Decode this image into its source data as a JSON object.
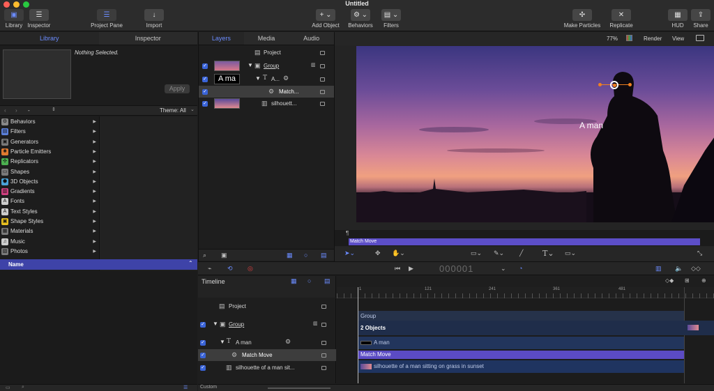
{
  "window": {
    "title": "Untitled"
  },
  "toolbar": {
    "library": "Library",
    "inspector": "Inspector",
    "project_pane": "Project Pane",
    "import": "Import",
    "add_object": "Add Object",
    "behaviors": "Behaviors",
    "filters": "Filters",
    "make_particles": "Make Particles",
    "replicate": "Replicate",
    "hud": "HUD",
    "share": "Share"
  },
  "left": {
    "tabs": [
      "Library",
      "Inspector"
    ],
    "nothing_selected": "Nothing Selected.",
    "apply": "Apply",
    "path_value": "-",
    "theme": "Theme: All",
    "categories": [
      "Behaviors",
      "Filters",
      "Generators",
      "Particle Emitters",
      "Replicators",
      "Shapes",
      "3D Objects",
      "Gradients",
      "Fonts",
      "Text Styles",
      "Shape Styles",
      "Materials",
      "Music",
      "Photos"
    ],
    "category_colors": [
      "#888888",
      "#5a7fd8",
      "#7a7a7a",
      "#e07a30",
      "#4caf50",
      "#7a7a7a",
      "#4aa3d8",
      "#d04080",
      "#cccccc",
      "#cccccc",
      "#e8c020",
      "#7a7a7a",
      "#cccccc",
      "#7a7a7a"
    ],
    "name_header": "Name"
  },
  "layers": {
    "tabs": [
      "Layers",
      "Media",
      "Audio"
    ],
    "project": "Project",
    "group": "Group",
    "text_layer": "A...",
    "text_thumb": "A ma",
    "match": "Match...",
    "silhouette": "silhouett..."
  },
  "canvas": {
    "zoom": "77%",
    "render": "Render",
    "view": "View",
    "overlay_text": "A man",
    "mini_timeline_label": "Match Move"
  },
  "transport": {
    "timecode": "000001"
  },
  "timeline": {
    "label": "Timeline",
    "ruler": [
      "1",
      "121",
      "241",
      "361",
      "481"
    ],
    "rows": {
      "project": "Project",
      "group": "Group",
      "a_man": "A man",
      "match_move": "Match Move",
      "silhouette": "silhouette of a man sit..."
    },
    "bars": {
      "group": "Group",
      "objects": "2 Objects",
      "a_man": "A man",
      "match_move": "Match Move",
      "silhouette": "silhouette of a man sitting on grass in sunset"
    },
    "footer": "Custom"
  }
}
